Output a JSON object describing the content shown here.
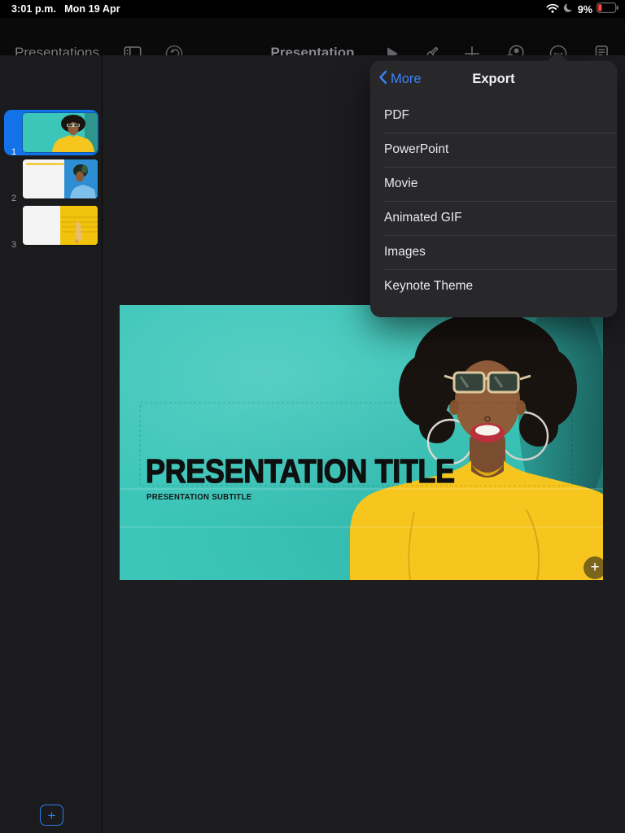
{
  "status_bar": {
    "time": "3:01 p.m.",
    "date": "Mon 19 Apr",
    "battery_percent": "9%"
  },
  "toolbar": {
    "back_label": "Presentations",
    "document_title": "Presentation"
  },
  "popover": {
    "back_label": "More",
    "title": "Export",
    "items": [
      "PDF",
      "PowerPoint",
      "Movie",
      "Animated GIF",
      "Images",
      "Keynote Theme"
    ]
  },
  "sidebar": {
    "slides": [
      {
        "number": "1"
      },
      {
        "number": "2"
      },
      {
        "number": "3"
      }
    ]
  },
  "slide": {
    "title": "PRESENTATION TITLE",
    "subtitle": "PRESENTATION SUBTITLE"
  },
  "colors": {
    "accent_blue": "#3e82f8",
    "selection_blue": "#1372e8",
    "slide_teal": "#3bc6b9",
    "sweater_yellow": "#f7c61e",
    "battery_red": "#ff453a"
  }
}
